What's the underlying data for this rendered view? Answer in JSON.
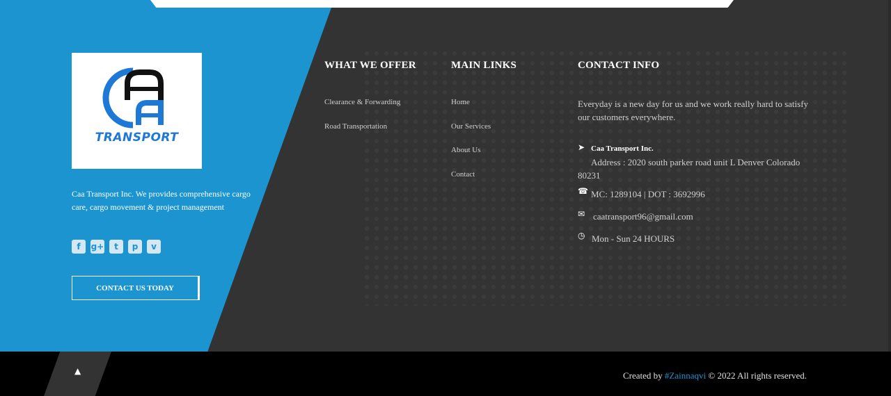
{
  "brand": {
    "logo_word": "TRANSPORT",
    "description": "Caa Transport Inc. We provides comprehensive cargo care, cargo movement & project management",
    "cta_label": "CONTACT US TODAY",
    "accent_color": "#1b94d0",
    "socials": [
      {
        "icon": "facebook-icon",
        "glyph": "f"
      },
      {
        "icon": "google-plus-icon",
        "glyph": "g+"
      },
      {
        "icon": "twitter-icon",
        "glyph": "t"
      },
      {
        "icon": "pinterest-icon",
        "glyph": "p"
      },
      {
        "icon": "vimeo-icon",
        "glyph": "v"
      }
    ]
  },
  "offer": {
    "heading": "WHAT WE OFFER",
    "links": [
      "Clearance & Forwarding",
      "Road Transportation"
    ]
  },
  "main_links": {
    "heading": "MAIN LINKS",
    "links": [
      "Home",
      "Our Services",
      "About Us",
      "Contact"
    ]
  },
  "contact": {
    "heading": "CONTACT INFO",
    "intro": "Everyday is a new day for us and we work really hard to satisfy our customers everywhere.",
    "company": "Caa Transport Inc.",
    "address": "Address : 2020 south parker road unit L Denver Colorado 80231",
    "phone": "MC: 1289104 | DOT : 3692996",
    "email": "caatransport96@gmail.com",
    "hours": "Mon - Sun 24 HOURS"
  },
  "footer": {
    "created_by": "Created by",
    "author": "#Zainnaqvi",
    "rights": "© 2022 All rights reserved."
  }
}
